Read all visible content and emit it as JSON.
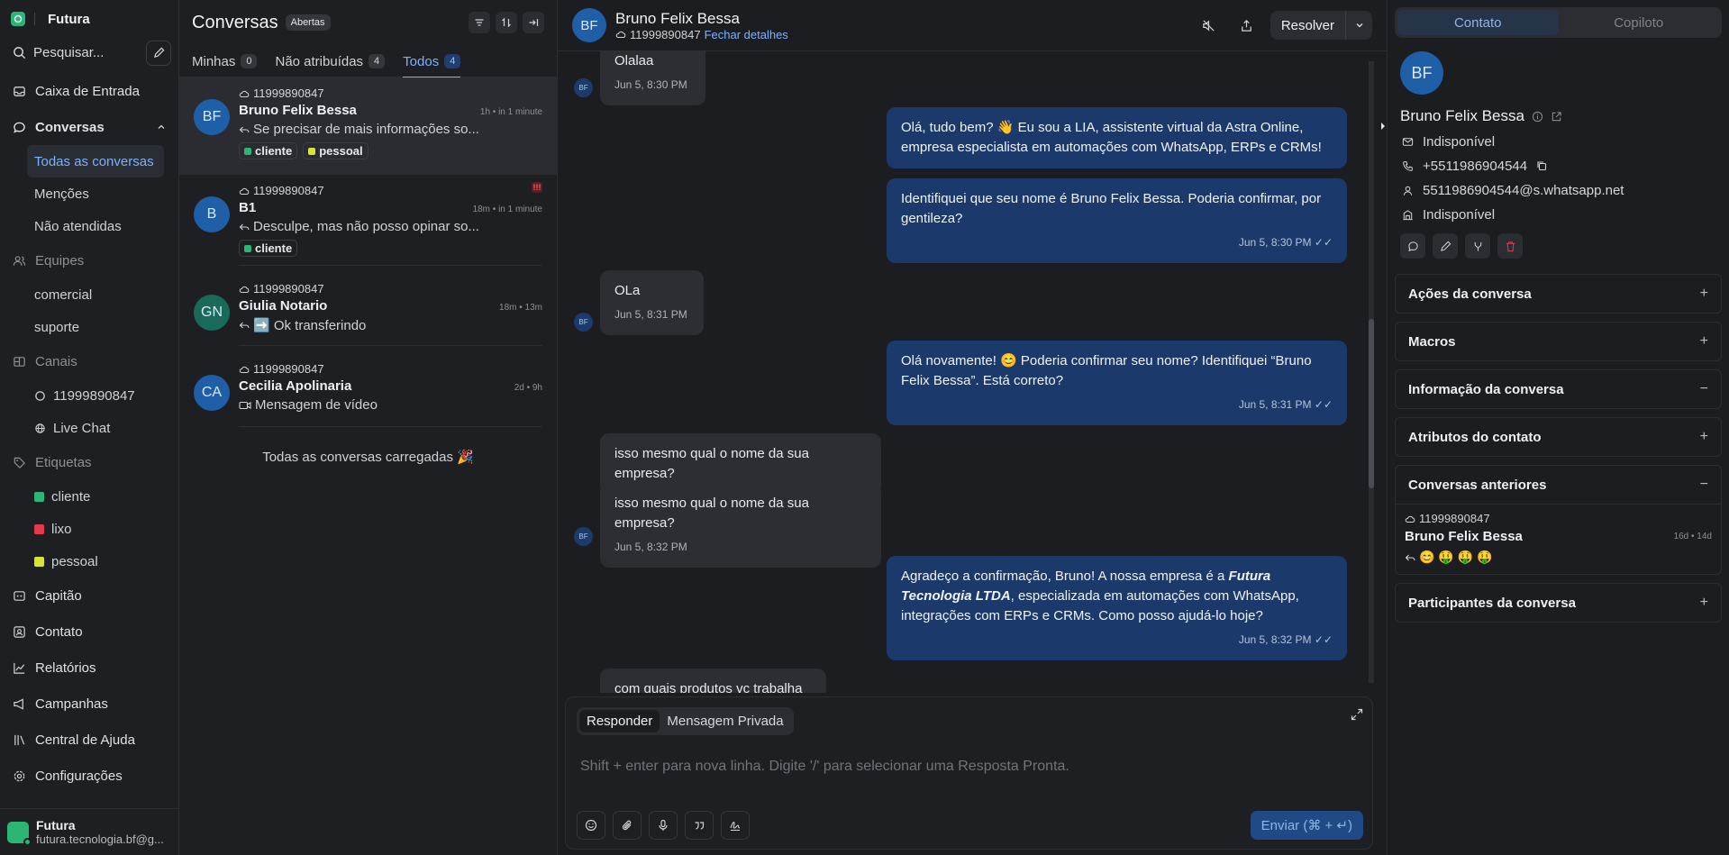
{
  "app": {
    "name": "Futura"
  },
  "sidebar": {
    "search_label": "Pesquisar...",
    "inbox": "Caixa de Entrada",
    "conversations": "Conversas",
    "conv_items": [
      "Todas as conversas",
      "Menções",
      "Não atendidas"
    ],
    "teams": "Equipes",
    "team_items": [
      "comercial",
      "suporte"
    ],
    "channels": "Canais",
    "channel_items": [
      "11999890847",
      "Live Chat"
    ],
    "labels": "Etiquetas",
    "label_items": [
      {
        "name": "cliente",
        "color": "#2bb673"
      },
      {
        "name": "lixo",
        "color": "#e23a4a"
      },
      {
        "name": "pessoal",
        "color": "#d8e23a"
      }
    ],
    "bottom": [
      "Capitão",
      "Contato",
      "Relatórios",
      "Campanhas",
      "Central de Ajuda",
      "Configurações"
    ],
    "footer": {
      "name": "Futura",
      "email": "futura.tecnologia.bf@g..."
    }
  },
  "list": {
    "title": "Conversas",
    "status": "Abertas",
    "tabs": [
      {
        "label": "Minhas",
        "count": "0"
      },
      {
        "label": "Não atribuídas",
        "count": "4"
      },
      {
        "label": "Todos",
        "count": "4"
      }
    ],
    "conversations": [
      {
        "channel": "11999890847",
        "initials": "BF",
        "name": "Bruno Felix Bessa",
        "time": "1h • in 1 minute",
        "message": "Se precisar de mais informações so...",
        "labels": [
          "cliente",
          "pessoal"
        ]
      },
      {
        "channel": "11999890847",
        "initials": "B",
        "name": "B1",
        "time": "18m • in 1 minute",
        "message": "Desculpe, mas não posso opinar so...",
        "labels": [
          "cliente"
        ],
        "urgent": "!!!"
      },
      {
        "channel": "11999890847",
        "initials": "GN",
        "name": "Giulia Notario",
        "time": "18m • 13m",
        "message": "➡️ Ok transferindo",
        "labels": []
      },
      {
        "channel": "11999890847",
        "initials": "CA",
        "name": "Cecilia Apolinaria",
        "time": "2d • 9h",
        "message": "Mensagem de vídeo",
        "labels": []
      }
    ],
    "loaded": "Todas as conversas carregadas 🎉"
  },
  "chat": {
    "initials": "BF",
    "name": "Bruno Felix Bessa",
    "channel": "11999890847",
    "close_details": "Fechar detalhes",
    "resolve": "Resolver",
    "messages": [
      {
        "dir": "in",
        "text": "Olalaa",
        "time": "Jun 5, 8:30 PM"
      },
      {
        "dir": "out",
        "text": "Olá, tudo bem? 👋 Eu sou a LIA, assistente virtual da Astra Online, empresa especialista em automações com WhatsApp, ERPs e CRMs!"
      },
      {
        "dir": "out",
        "text": "Identifiquei que seu nome é Bruno Felix Bessa. Poderia confirmar, por gentileza?",
        "time": "Jun 5, 8:30 PM"
      },
      {
        "dir": "in",
        "text": "OLa",
        "time": "Jun 5, 8:31 PM"
      },
      {
        "dir": "out",
        "text": "Olá novamente! 😊 Poderia confirmar seu nome? Identifiquei “Bruno Felix Bessa”. Está correto?",
        "time": "Jun 5, 8:31 PM"
      },
      {
        "dir": "in",
        "text": "isso mesmo qual o nome da sua empresa?"
      },
      {
        "dir": "in",
        "text": "isso mesmo qual o nome da sua empresa?",
        "time": "Jun 5, 8:32 PM"
      },
      {
        "dir": "out",
        "text_before": "Agradeço a confirmação, Bruno! A nossa empresa é a ",
        "text_bold": "Futura Tecnologia LTDA",
        "text_after": ", especializada em automações com WhatsApp, integrações com ERPs e CRMs. Como posso ajudá-lo hoje?",
        "time": "Jun 5, 8:32 PM"
      },
      {
        "dir": "in",
        "text": "com quais produtos vc trabalha ?"
      }
    ],
    "sender_initials": "BF",
    "composer": {
      "tab_reply": "Responder",
      "tab_private": "Mensagem Privada",
      "placeholder": "Shift + enter para nova linha. Digite '/' para selecionar uma Resposta Pronta.",
      "send": "Enviar (⌘ + ↵)"
    }
  },
  "panel": {
    "tabs": [
      "Contato",
      "Copiloto"
    ],
    "initials": "BF",
    "name": "Bruno Felix Bessa",
    "email": "Indisponível",
    "phone": "+5511986904544",
    "identifier": "5511986904544@s.whatsapp.net",
    "company": "Indisponível",
    "sections": {
      "actions": "Ações da conversa",
      "macros": "Macros",
      "info": "Informação da conversa",
      "attributes": "Atributos do contato",
      "previous": "Conversas anteriores",
      "participants": "Participantes da conversa"
    },
    "previous": {
      "channel": "11999890847",
      "name": "Bruno Felix Bessa",
      "time": "16d • 14d",
      "message": "😊 🤑 🤑 🤑"
    }
  }
}
